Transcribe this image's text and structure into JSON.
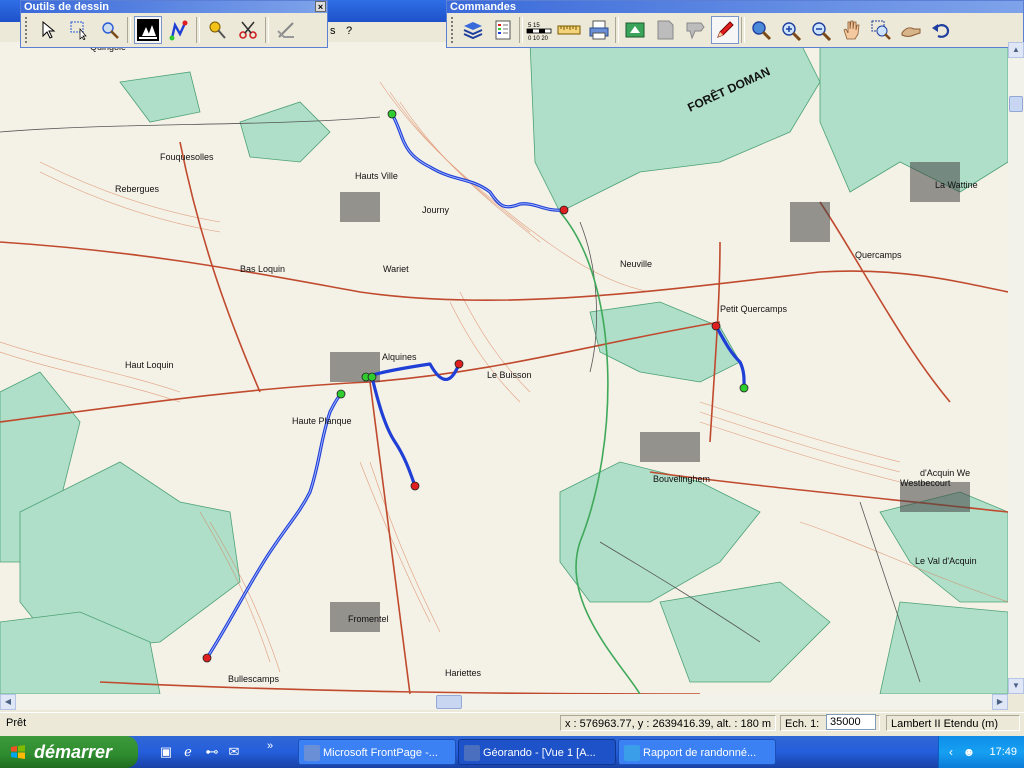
{
  "menubar": {
    "items": [
      "s",
      "?"
    ]
  },
  "drawing_palette": {
    "title": "Outils de dessin",
    "close_label": "×",
    "tools": [
      "arrow-icon",
      "select-rect-icon",
      "zoom-select-icon",
      "forest-symbol-icon",
      "route-tool-icon",
      "pin-icon",
      "scissors-icon",
      "eraser-icon"
    ]
  },
  "commands_palette": {
    "title": "Commandes",
    "tools": [
      "layers-icon",
      "legend-icon",
      "scale-bar-icon",
      "ruler-icon",
      "print-icon",
      "export-icon",
      "page-icon",
      "tag-icon",
      "pencil-icon",
      "zoom-icon",
      "zoom-in-icon",
      "zoom-out-icon",
      "hand-icon",
      "zoom-window-icon",
      "pan-icon",
      "undo-icon"
    ]
  },
  "map": {
    "labels": [
      "Quingoie",
      "Rebergues",
      "Fouquesolles",
      "Hauts Ville",
      "Journy",
      "Bas Loquin",
      "Wariet",
      "Alquines",
      "Le Buisson",
      "Haut Loquin",
      "Haute Planque",
      "Bouvelinghem",
      "Neuville",
      "Quercamps",
      "Petit Quercamps",
      "La Wattine",
      "Westbecourt",
      "Le Val d'Acquin",
      "d'Acquin We",
      "Fromentel",
      "Bullescamps",
      "Hariettes",
      "FORÊT DOMAN"
    ],
    "colors": {
      "route": "#1f3fd6",
      "start": "#2ecc2e",
      "end": "#e02020",
      "forest": "#a8dcc6",
      "road": "#e05a3a",
      "contour": "#d97a50"
    }
  },
  "status": {
    "ready": "Prêt",
    "coords": "x : 576963.77, y : 2639416.39, alt. : 180 m",
    "scale_label": "Ech. 1:",
    "scale_value": "35000",
    "projection": "Lambert II Etendu (m)"
  },
  "taskbar": {
    "start_label": "démarrer",
    "tasks": [
      {
        "label": "Microsoft FrontPage -...",
        "active": false,
        "icon_color": "#6b8fd6"
      },
      {
        "label": "Géorando - [Vue 1 [A...",
        "active": true,
        "icon_color": "#4a6fbf"
      },
      {
        "label": "Rapport de randonné...",
        "active": false,
        "icon_color": "#3a9ee8"
      }
    ],
    "clock": "17:49"
  }
}
